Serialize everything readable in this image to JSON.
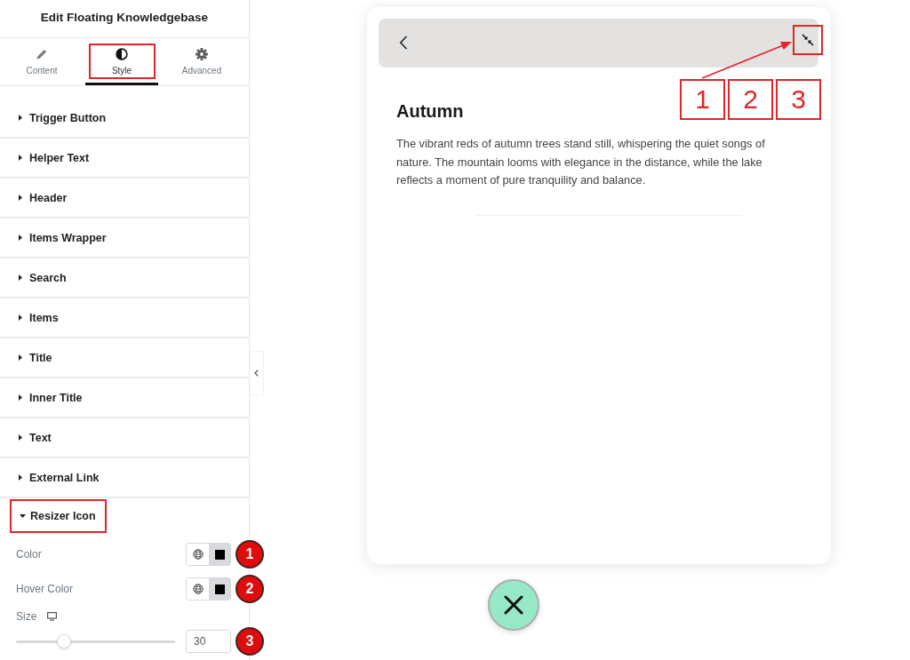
{
  "panel": {
    "title": "Edit Floating Knowledgebase",
    "tabs": [
      {
        "label": "Content",
        "selected": false,
        "highlighted": false
      },
      {
        "label": "Style",
        "selected": true,
        "highlighted": true
      },
      {
        "label": "Advanced",
        "selected": false,
        "highlighted": false
      }
    ],
    "sections": [
      {
        "label": "Trigger Button",
        "expanded": false,
        "highlighted": false
      },
      {
        "label": "Helper Text",
        "expanded": false,
        "highlighted": false
      },
      {
        "label": "Header",
        "expanded": false,
        "highlighted": false
      },
      {
        "label": "Items Wrapper",
        "expanded": false,
        "highlighted": false
      },
      {
        "label": "Search",
        "expanded": false,
        "highlighted": false
      },
      {
        "label": "Items",
        "expanded": false,
        "highlighted": false
      },
      {
        "label": "Title",
        "expanded": false,
        "highlighted": false
      },
      {
        "label": "Inner Title",
        "expanded": false,
        "highlighted": false
      },
      {
        "label": "Text",
        "expanded": false,
        "highlighted": false
      },
      {
        "label": "External Link",
        "expanded": false,
        "highlighted": false
      },
      {
        "label": "Resizer Icon",
        "expanded": true,
        "highlighted": true,
        "controls": [
          {
            "kind": "color",
            "label": "Color",
            "badge": "1"
          },
          {
            "kind": "color",
            "label": "Hover Color",
            "badge": "2"
          },
          {
            "kind": "slider",
            "label": "Size",
            "level": 0.3,
            "value": "30",
            "badge": "3"
          }
        ]
      }
    ]
  },
  "preview": {
    "resizer": {
      "highlighted": true
    },
    "title": "Autumn",
    "text": "The vibrant reds of autumn trees stand still, whispering the quiet songs of nature. The mountain looms with elegance in the distance, while the lake reflects a moment of pure tranquility and balance.",
    "callouts": [
      "1",
      "2",
      "3"
    ]
  }
}
